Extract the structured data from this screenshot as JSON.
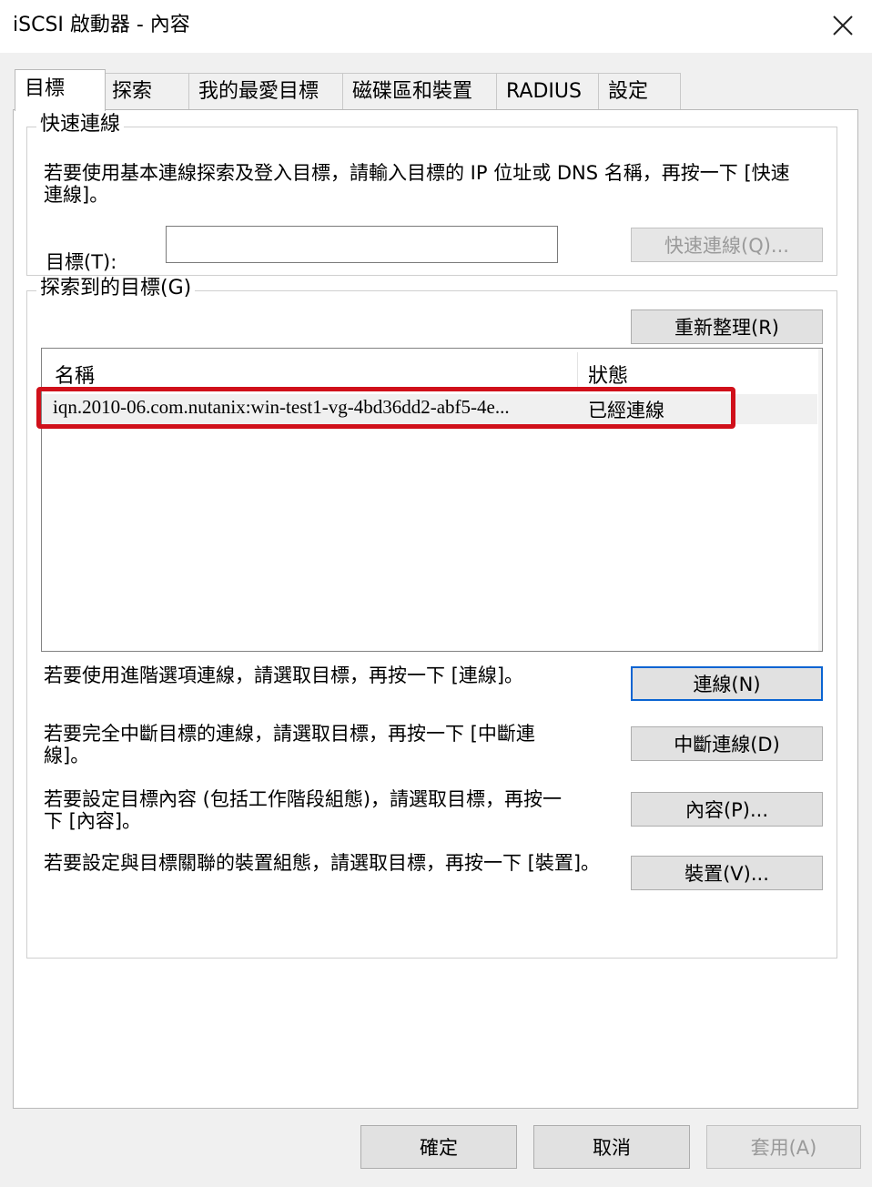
{
  "window": {
    "title": "iSCSI 啟動器 - 內容",
    "close_icon": "close-icon"
  },
  "tabs": [
    {
      "label": "目標",
      "active": true
    },
    {
      "label": "探索",
      "active": false
    },
    {
      "label": "我的最愛目標",
      "active": false
    },
    {
      "label": "磁碟區和裝置",
      "active": false
    },
    {
      "label": "RADIUS",
      "active": false
    },
    {
      "label": "設定",
      "active": false
    }
  ],
  "quick_connect": {
    "legend": "快速連線",
    "description": "若要使用基本連線探索及登入目標，請輸入目標的 IP 位址或 DNS 名稱，再按一下 [快速連線]。",
    "target_label": "目標(T):",
    "target_value": "",
    "button": "快速連線(Q)..."
  },
  "discovered": {
    "legend": "探索到的目標(G)",
    "refresh_button": "重新整理(R)",
    "columns": {
      "name": "名稱",
      "status": "狀態"
    },
    "rows": [
      {
        "name": "iqn.2010-06.com.nutanix:win-test1-vg-4bd36dd2-abf5-4e...",
        "status": "已經連線"
      }
    ]
  },
  "actions": [
    {
      "text": "若要使用進階選項連線，請選取目標，再按一下 [連線]。",
      "button": "連線(N)"
    },
    {
      "text": "若要完全中斷目標的連線，請選取目標，再按一下 [中斷連線]。",
      "button": "中斷連線(D)"
    },
    {
      "text": "若要設定目標內容 (包括工作階段組態)，請選取目標，再按一下 [內容]。",
      "button": "內容(P)..."
    },
    {
      "text": "若要設定與目標關聯的裝置組態，請選取目標，再按一下 [裝置]。",
      "button": "裝置(V)..."
    }
  ],
  "footer": {
    "ok": "確定",
    "cancel": "取消",
    "apply": "套用(A)"
  },
  "colors": {
    "highlight": "#d0101a",
    "default_button_border": "#0a64d2"
  }
}
